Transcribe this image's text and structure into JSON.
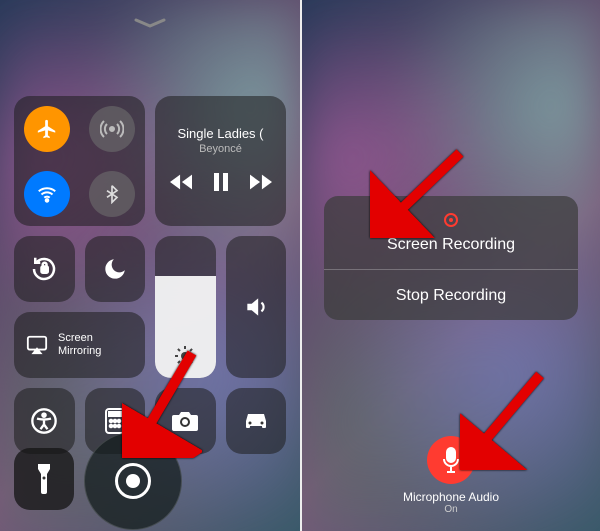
{
  "left": {
    "music": {
      "title": "Single Ladies (",
      "artist": "Beyoncé"
    },
    "mirror_label": "Screen\nMirroring",
    "connectivity": {
      "airplane": {
        "on": true,
        "color": "#ff9500"
      },
      "cellular": {
        "on": false
      },
      "wifi": {
        "on": true,
        "color": "#007aff"
      },
      "bluetooth": {
        "on": false
      }
    }
  },
  "right": {
    "popup": {
      "title": "Screen Recording",
      "stop": "Stop Recording"
    },
    "mic": {
      "label": "Microphone Audio",
      "state": "On",
      "on": true
    }
  },
  "colors": {
    "accent_red": "#ff3b30",
    "accent_orange": "#ff9500",
    "accent_blue": "#007aff"
  }
}
